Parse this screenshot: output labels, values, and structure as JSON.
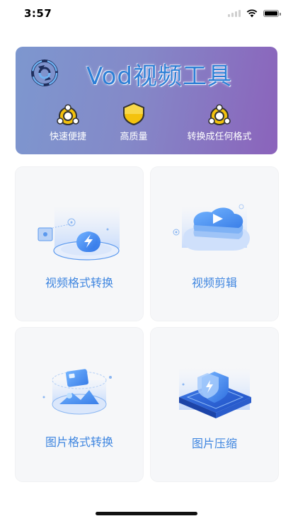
{
  "status_bar": {
    "time": "3:57"
  },
  "banner": {
    "title": "Vod视频工具",
    "features": [
      {
        "icon": "cycle-icon",
        "label": "快速便捷"
      },
      {
        "icon": "shield-icon",
        "label": "高质量"
      },
      {
        "icon": "cycle-icon",
        "label": "转换成任何格式"
      }
    ]
  },
  "cards": [
    {
      "label": "视频格式转换",
      "icon": "lightning-icon"
    },
    {
      "label": "视频剪辑",
      "icon": "video-layers-icon"
    },
    {
      "label": "图片格式转换",
      "icon": "image-icon"
    },
    {
      "label": "图片压缩",
      "icon": "compress-shield-icon"
    }
  ],
  "colors": {
    "accent": "#3f86e0",
    "banner_start": "#7d97cf",
    "banner_end": "#8b63bb",
    "card_bg": "#f6f7f9"
  }
}
